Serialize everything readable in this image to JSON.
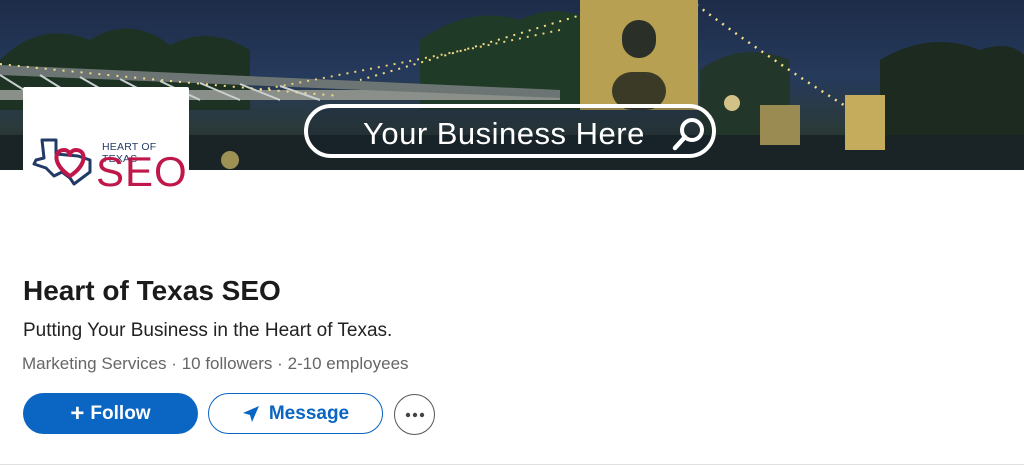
{
  "banner": {
    "search_text": "Your Business Here",
    "icon": "magnifier-icon"
  },
  "logo": {
    "top_text": "HEART OF TEXAS",
    "main_text": "SEO",
    "colors": {
      "navy": "#223b66",
      "crimson": "#c0174a"
    }
  },
  "company": {
    "name": "Heart of Texas SEO",
    "tagline": "Putting Your Business in the Heart of Texas.",
    "industry": "Marketing Services",
    "followers": "10 followers",
    "employees": "2-10 employees",
    "separator": "·"
  },
  "actions": {
    "follow_label": "Follow",
    "follow_icon": "plus-icon",
    "message_label": "Message",
    "message_icon": "send-icon",
    "more_icon": "ellipsis-icon"
  },
  "colors": {
    "accent": "#0a66c2",
    "muted_text": "#666666"
  }
}
